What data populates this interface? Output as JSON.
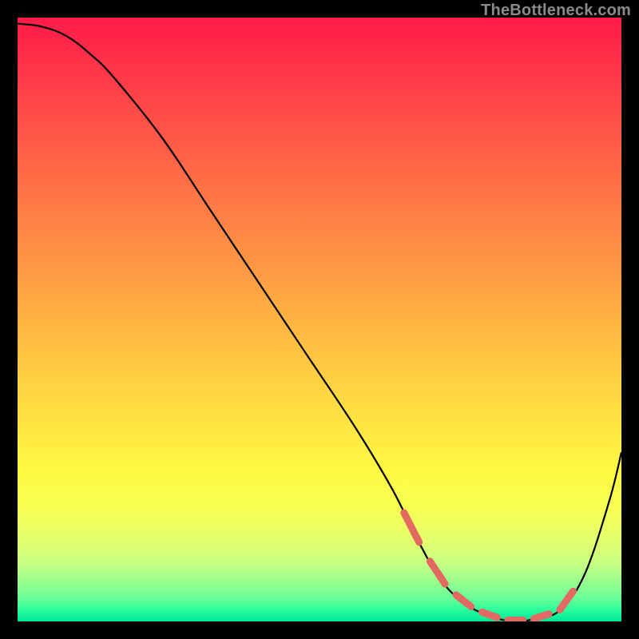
{
  "watermark": "TheBottleneck.com",
  "chart_data": {
    "type": "line",
    "title": "",
    "xlabel": "",
    "ylabel": "",
    "xlim": [
      0,
      100
    ],
    "ylim": [
      0,
      100
    ],
    "grid": false,
    "series": [
      {
        "name": "curve",
        "x": [
          0,
          4,
          8,
          12,
          16,
          24,
          32,
          40,
          48,
          56,
          62,
          66,
          70,
          74,
          78,
          82,
          86,
          90,
          94,
          98,
          100
        ],
        "y": [
          99,
          98.5,
          97,
          94,
          90,
          80,
          68,
          56,
          44,
          32,
          22,
          14,
          7,
          3,
          1,
          0,
          0.5,
          2,
          8,
          20,
          28
        ]
      }
    ],
    "annotations": {
      "dashed_segments_x_range": [
        64,
        92
      ],
      "dashed_color": "#e26a62"
    }
  }
}
